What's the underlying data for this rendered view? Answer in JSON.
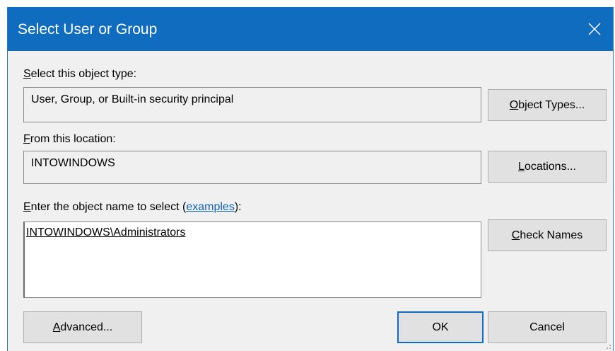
{
  "window": {
    "title": "Select User or Group",
    "close_label": "Close"
  },
  "object_type": {
    "label_access": "S",
    "label_rest": "elect this object type:",
    "value": "User, Group, or Built-in security principal",
    "button_access": "O",
    "button_rest": "bject Types..."
  },
  "location": {
    "label_access": "F",
    "label_rest": "rom this location:",
    "value": "INTOWINDOWS",
    "button_access": "L",
    "button_rest": "ocations..."
  },
  "object_name": {
    "label_access": "E",
    "label_rest": "nter the object name to select (",
    "link_text": "examples",
    "label_end": "):",
    "value": "INTOWINDOWS\\Administrators",
    "check_access": "C",
    "check_rest": "heck Names"
  },
  "footer": {
    "advanced_access": "A",
    "advanced_rest": "dvanced...",
    "ok_label": "OK",
    "cancel_label": "Cancel"
  },
  "colors": {
    "titlebar": "#0f6cbf",
    "link": "#0b62c4",
    "default_button_border": "#0f6cbf"
  }
}
